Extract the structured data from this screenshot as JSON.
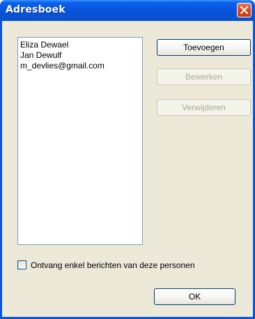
{
  "window": {
    "title": "Adresboek"
  },
  "addressbook": {
    "entries": [
      "Eliza Dewael",
      "Jan Dewulf",
      "m_devlies@gmail.com"
    ]
  },
  "buttons": {
    "add_label": "Toevoegen",
    "edit_label": "Bewerken",
    "delete_label": "Verwijderen",
    "ok_label": "OK"
  },
  "filter": {
    "label": "Ontvang enkel berichten van deze personen",
    "checked": false
  },
  "colors": {
    "titlebar": "#0852d8",
    "dialog_bg": "#ece9d8",
    "close_button": "#d9481e",
    "disabled_text": "#aca899"
  }
}
